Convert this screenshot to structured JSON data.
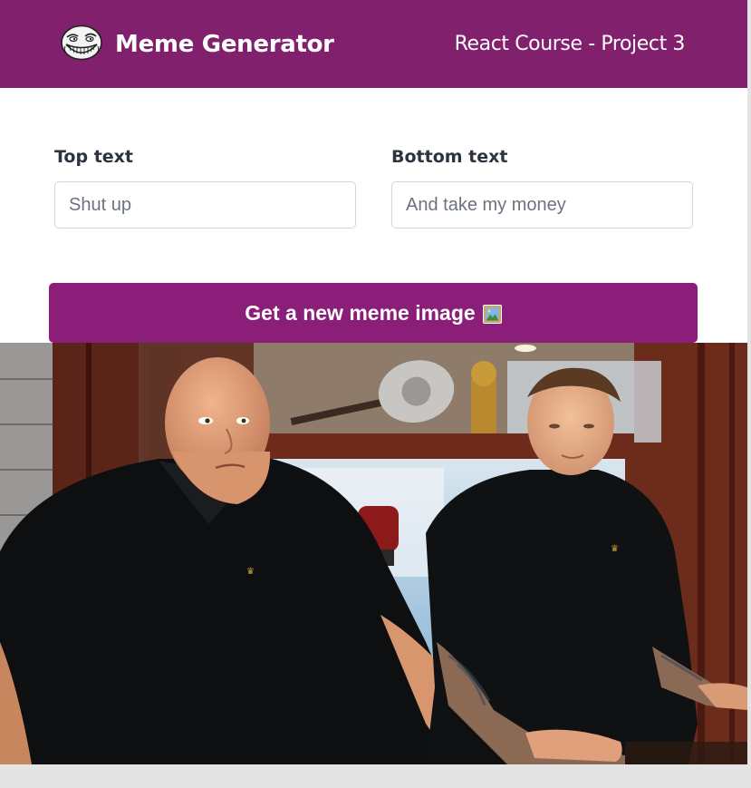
{
  "header": {
    "logo_icon": "troll-face-icon",
    "title": "Meme Generator",
    "subtitle": "React Course - Project 3"
  },
  "form": {
    "top_label": "Top text",
    "top_placeholder": "Shut up",
    "bottom_label": "Bottom text",
    "bottom_placeholder": "And take my money",
    "button_label": "Get a new meme image",
    "button_icon": "framed-picture-icon"
  },
  "meme": {
    "image": "two men in black polo shirts leaning on a pawn shop glass counter",
    "top_text": "",
    "bottom_text": ""
  },
  "colors": {
    "brand": "#81206c",
    "button": "#8a1e78"
  }
}
